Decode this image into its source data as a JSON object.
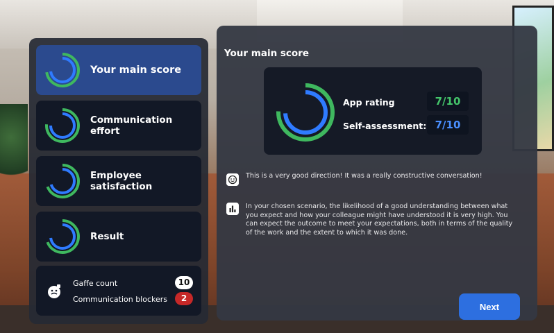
{
  "nav": {
    "items": [
      {
        "label": "Your main score",
        "active": true
      },
      {
        "label": "Communication effort",
        "active": false
      },
      {
        "label": "Employee satisfaction",
        "active": false
      },
      {
        "label": "Result",
        "active": false
      }
    ]
  },
  "stats": {
    "gaffe_label": "Gaffe count",
    "gaffe_value": "10",
    "blockers_label": "Communication blockers",
    "blockers_value": "2"
  },
  "main": {
    "title": "Your main score",
    "app_rating_label": "App rating",
    "app_rating_value": "7/10",
    "self_assessment_label": "Self-assessment:",
    "self_assessment_value": "7/10",
    "message_1": "This is a very good direction! It was a really constructive conversation!",
    "message_2": "In your chosen scenario, the likelihood of a good understanding between what you expect and how your colleague might have understood it is very high. You can expect the outcome to meet your expectations, both in terms of the quality of the work and the extent to which it was done.",
    "next_label": "Next"
  },
  "colors": {
    "accent_green": "#3fb85f",
    "accent_blue": "#2f7bff",
    "active_nav": "#2b4a8e",
    "badge_red": "#c62828",
    "button_blue": "#2d6fe0"
  },
  "icons": [
    "smiley-icon",
    "bar-chart-icon",
    "gaffe-face-icon",
    "progress-ring-icon"
  ]
}
